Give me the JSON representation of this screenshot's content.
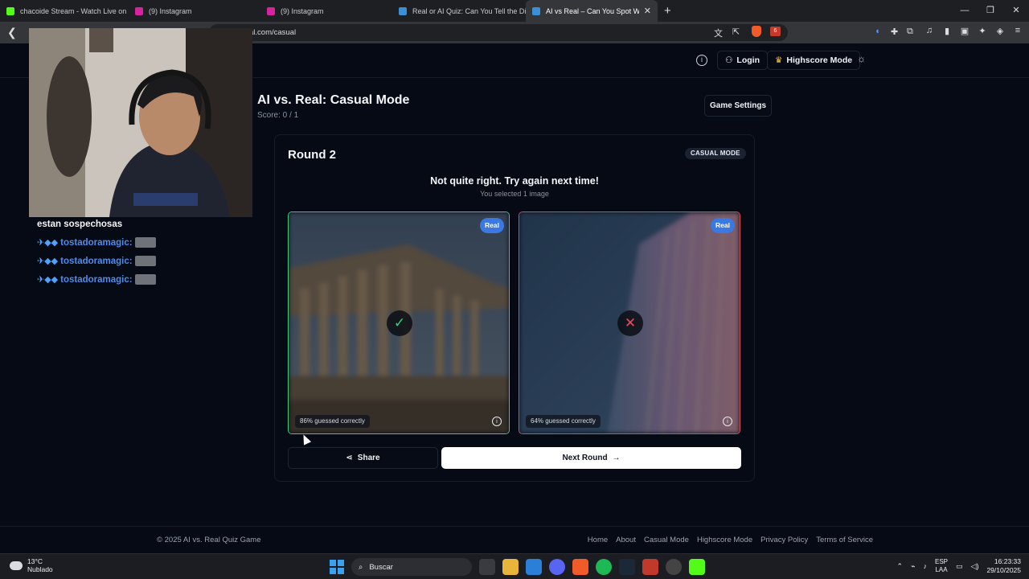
{
  "browser": {
    "tabs": [
      {
        "title": "chacoide Stream - Watch Live on",
        "color": "#53fc18",
        "active": false
      },
      {
        "title": "(9) Instagram",
        "color": "#d6249f",
        "active": false
      },
      {
        "title": "(9) Instagram",
        "color": "#d6249f",
        "active": false
      },
      {
        "title": "Real or AI Quiz: Can You Tell the Diffe",
        "color": "#3b8fd6",
        "active": false
      },
      {
        "title": "AI vs Real – Can You Spot What's",
        "color": "#3b8fd6",
        "active": true
      }
    ],
    "url": "al.com/casual",
    "alert_count": "6"
  },
  "header": {
    "login_label": "Login",
    "highscore_label": "Highscore Mode"
  },
  "page": {
    "title": "AI vs. Real: Casual Mode",
    "score": "Score: 0 / 1",
    "game_settings_label": "Game Settings"
  },
  "round": {
    "title": "Round 2",
    "mode_badge": "CASUAL MODE",
    "result_message": "Not quite right. Try again next time!",
    "selected_message": "You selected 1 image",
    "images": [
      {
        "label": "Real",
        "guessed": "86% guessed correctly",
        "verdict": "correct",
        "subject": "greek-temple-ruins"
      },
      {
        "label": "Real",
        "guessed": "64% guessed correctly",
        "verdict": "incorrect",
        "subject": "glass-skyscraper"
      }
    ],
    "share_label": "Share",
    "next_label": "Next Round"
  },
  "footer": {
    "copyright": "© 2025 AI vs. Real Quiz Game",
    "links": [
      "Home",
      "About",
      "Casual Mode",
      "Highscore Mode",
      "Privacy Policy",
      "Terms of Service"
    ]
  },
  "stream": {
    "chat": [
      {
        "text": "estan sospechosas"
      },
      {
        "user": "tostadoramagic:"
      },
      {
        "user": "tostadoramagic:"
      },
      {
        "user": "tostadoramagic:"
      }
    ]
  },
  "taskbar": {
    "temperature": "13°C",
    "weather": "Nublado",
    "search_placeholder": "Buscar",
    "lang_top": "ESP",
    "lang_bottom": "LAA",
    "time": "16:23:33",
    "date": "29/10/2025"
  }
}
